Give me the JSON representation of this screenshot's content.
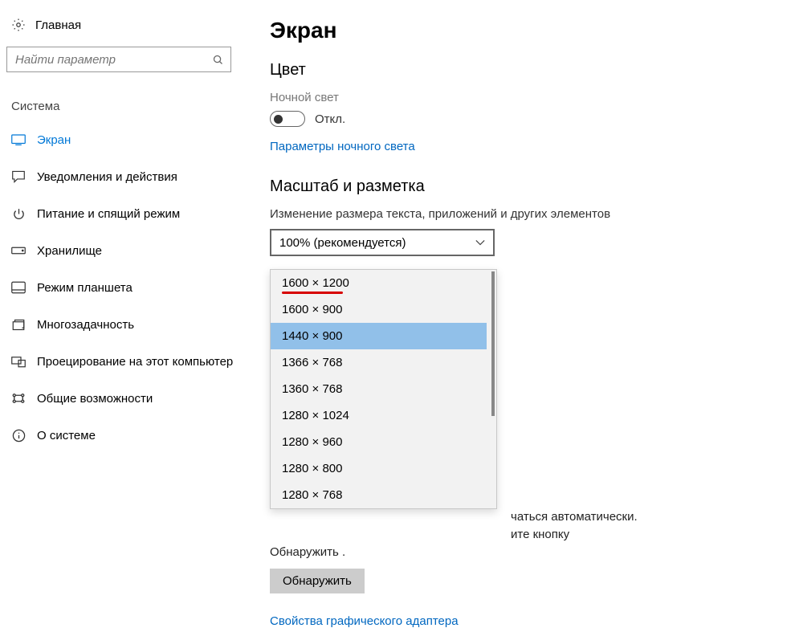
{
  "sidebar": {
    "home_label": "Главная",
    "search_placeholder": "Найти параметр",
    "category_label": "Система",
    "items": [
      {
        "label": "Экран"
      },
      {
        "label": "Уведомления и действия"
      },
      {
        "label": "Питание и спящий режим"
      },
      {
        "label": "Хранилище"
      },
      {
        "label": "Режим планшета"
      },
      {
        "label": "Многозадачность"
      },
      {
        "label": "Проецирование на этот компьютер"
      },
      {
        "label": "Общие возможности"
      },
      {
        "label": "О системе"
      }
    ]
  },
  "page": {
    "title": "Экран",
    "sections": {
      "color": {
        "title": "Цвет",
        "night_light_label": "Ночной свет",
        "night_light_state": "Откл.",
        "night_light_settings_link": "Параметры ночного света"
      },
      "scale": {
        "title": "Масштаб и разметка",
        "scale_label": "Изменение размера текста, приложений и других элементов",
        "scale_value": "100% (рекомендуется)"
      }
    },
    "resolution_dropdown": {
      "options": [
        "1600 × 1200",
        "1600 × 900",
        "1440 × 900",
        "1366 × 768",
        "1360 × 768",
        "1280 × 1024",
        "1280 × 960",
        "1280 × 800",
        "1280 × 768"
      ],
      "highlighted_index": 2,
      "underlined_index": 0
    },
    "obscured_text": {
      "frag1": "чаться автоматически.",
      "frag2": "ите кнопку",
      "frag3": "Обнаружить .",
      "detect_button": "Обнаружить"
    },
    "adapter_link": "Свойства графического адаптера"
  }
}
